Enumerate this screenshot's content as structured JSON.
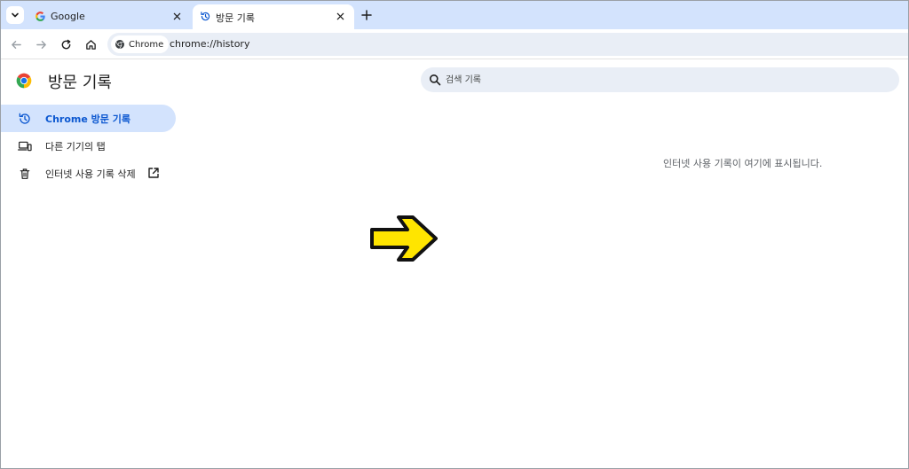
{
  "tabs": [
    {
      "title": "Google",
      "icon": "google-icon"
    },
    {
      "title": "방문 기록",
      "icon": "history-icon"
    }
  ],
  "toolbar": {
    "chip_label": "Chrome",
    "url": "chrome://history"
  },
  "page": {
    "title": "방문 기록",
    "search_placeholder": "검색 기록",
    "empty_message": "인터넷 사용 기록이 여기에 표시됩니다."
  },
  "sidebar": {
    "items": [
      {
        "label": "Chrome 방문 기록",
        "icon": "history-icon",
        "selected": true
      },
      {
        "label": "다른 기기의 탭",
        "icon": "devices-icon"
      },
      {
        "label": "인터넷 사용 기록 삭제",
        "icon": "trash-icon",
        "external": true
      }
    ]
  },
  "colors": {
    "accent": "#0b57d0",
    "tabstrip": "#d3e3fd",
    "arrow": "#ffe500"
  }
}
